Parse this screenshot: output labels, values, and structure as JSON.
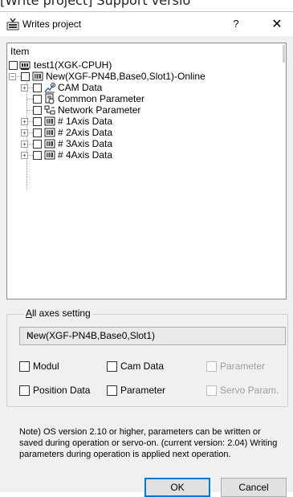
{
  "background_heading": "[Write project] Support versio",
  "dialog": {
    "title": "Writes project",
    "help_label": "?",
    "close_label": "✕"
  },
  "tree": {
    "header": "Item",
    "project": "test1(XGK-CPUH)",
    "module": "New(XGF-PN4B,Base0,Slot1)-Online",
    "items": [
      {
        "label": "CAM Data",
        "icon": "cam-icon",
        "expandable": true
      },
      {
        "label": "Common Parameter",
        "icon": "parameter-icon",
        "expandable": false
      },
      {
        "label": "Network Parameter",
        "icon": "network-icon",
        "expandable": false
      },
      {
        "label": "# 1Axis Data",
        "icon": "axis-icon",
        "expandable": true
      },
      {
        "label": "# 2Axis Data",
        "icon": "axis-icon",
        "expandable": true
      },
      {
        "label": "# 3Axis Data",
        "icon": "axis-icon",
        "expandable": true
      },
      {
        "label": "# 4Axis Data",
        "icon": "axis-icon",
        "expandable": true
      }
    ]
  },
  "axes_setting": {
    "group_label": "All axes setting",
    "group_label_mnemonic": "A",
    "group_label_rest": "ll axes setting",
    "selected": "New(XGF-PN4B,Base0,Slot1)",
    "checkboxes": {
      "modul": "Modul",
      "cam_data": "Cam Data",
      "parameter_disabled": "Parameter",
      "position_data": "Position Data",
      "parameter": "Parameter",
      "servo_param": "Servo Param."
    }
  },
  "note": "Note) OS version 2.10 or higher, parameters can be written or saved during operation or servo-on. (current version: 2.04) Writing parameters during operation is applied next operation.",
  "buttons": {
    "ok": "OK",
    "cancel": "Cancel"
  },
  "colors": {
    "dialog_bg": "#f0f0f0",
    "default_button_border": "#0078d7",
    "disabled_text": "#9e9e9e"
  }
}
